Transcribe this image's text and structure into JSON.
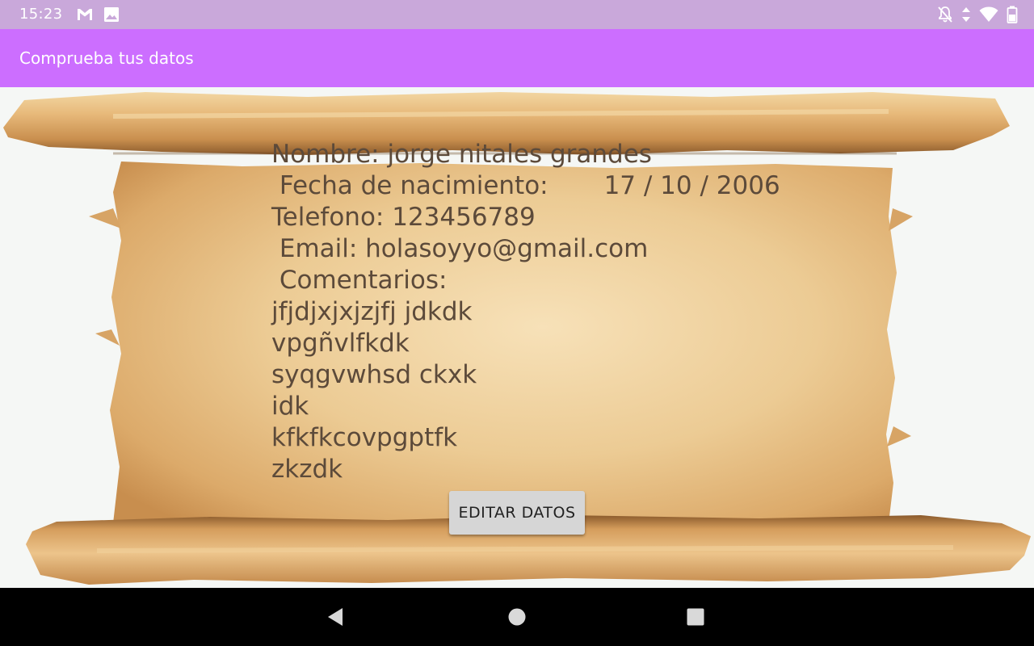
{
  "status_bar": {
    "time": "15:23",
    "icons_left": [
      "gmail-icon",
      "image-icon"
    ],
    "icons_right": [
      "notifications-off-icon",
      "data-arrows-icon",
      "wifi-icon",
      "battery-icon"
    ]
  },
  "app_bar": {
    "title": "Comprueba tus datos"
  },
  "profile": {
    "nombre": "Nombre: jorge nitales grandes",
    "fecha": " Fecha de nacimiento:       17 / 10 / 2006",
    "telefono": "Telefono: 123456789",
    "email": " Email: holasoyyo@gmail.com",
    "comentarios_label": " Comentarios:",
    "comentarios": [
      "jfjdjxjxjzjfj jdkdk",
      "vpgñvlfkdk",
      "syqgvwhsd ckxk",
      "idk",
      "kfkfkcovpgptfk",
      "zkzdk"
    ]
  },
  "actions": {
    "edit_label": "EDITAR DATOS"
  },
  "colors": {
    "status_bar": "#c9a8da",
    "app_bar": "#cc6eff",
    "parchment": "#e7bf84",
    "text": "#5c4a3a"
  }
}
